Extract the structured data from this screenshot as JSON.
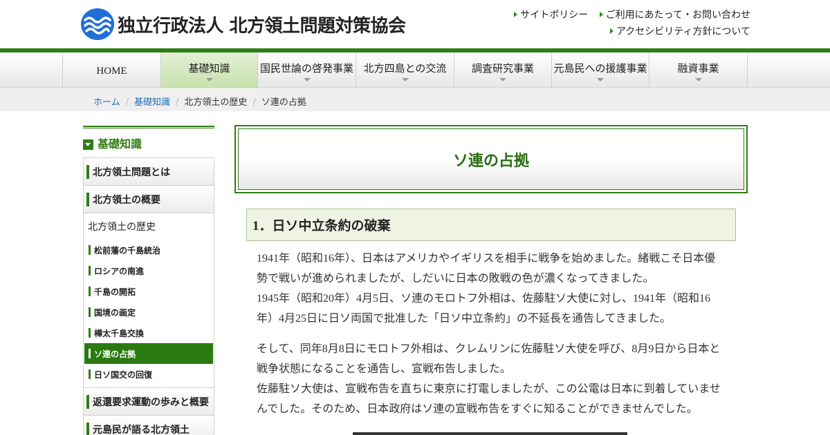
{
  "header": {
    "org_name": "独立行政法人 北方領土問題対策協会",
    "util_links": [
      [
        "サイトポリシー",
        "ご利用にあたって・お問い合わせ"
      ],
      [
        "アクセシビリティ方針について"
      ]
    ],
    "brand_color": "#2f7d16",
    "logo_color": "#1f6fd6"
  },
  "global_nav": [
    {
      "label": "HOME",
      "active": false,
      "has_dropdown": false
    },
    {
      "label": "基礎知識",
      "active": true,
      "has_dropdown": true
    },
    {
      "label": "国民世論の啓発事業",
      "active": false,
      "has_dropdown": true
    },
    {
      "label": "北方四島との交流",
      "active": false,
      "has_dropdown": true
    },
    {
      "label": "調査研究事業",
      "active": false,
      "has_dropdown": true
    },
    {
      "label": "元島民への援護事業",
      "active": false,
      "has_dropdown": true
    },
    {
      "label": "融資事業",
      "active": false,
      "has_dropdown": true
    }
  ],
  "breadcrumb": {
    "links": [
      "ホーム",
      "基礎知識"
    ],
    "texts": [
      "北方領土の歴史",
      "ソ連の占拠"
    ]
  },
  "side_nav": {
    "heading": "基礎知識",
    "majors_top": [
      "北方領土問題とは",
      "北方領土の概要"
    ],
    "sub_heading": "北方領土の歴史",
    "minors": [
      {
        "label": "松前藩の千島統治",
        "active": false
      },
      {
        "label": "ロシアの南進",
        "active": false
      },
      {
        "label": "千島の開拓",
        "active": false
      },
      {
        "label": "国境の画定",
        "active": false
      },
      {
        "label": "樺太千島交換",
        "active": false
      },
      {
        "label": "ソ連の占拠",
        "active": true
      },
      {
        "label": "日ソ国交の回復",
        "active": false
      }
    ],
    "majors_bottom": [
      "返還要求運動の歩みと概要",
      "元島民が語る北方領土"
    ]
  },
  "main": {
    "page_title": "ソ連の占拠",
    "section_heading": "1．日ソ中立条約の破棄",
    "paragraphs": [
      [
        "1941年（昭和16年）、日本はアメリカやイギリスを相手に戦争を始めました。緒戦こそ日本優",
        "勢で戦いが進められましたが、しだいに日本の敗戦の色が濃くなってきました。",
        "1945年（昭和20年）4月5日、ソ連のモロトフ外相は、佐藤駐ソ大使に対し、1941年（昭和16",
        "年）4月25日に日ソ両国で批准した「日ソ中立条約」の不延長を通告してきました。"
      ],
      [
        "そして、同年8月8日にモロトフ外相は、クレムリンに佐藤駐ソ大使を呼び、8月9日から日本と",
        "戦争状態になることを通告し、宣戦布告しました。",
        "佐藤駐ソ大使は、宣戦布告を直ちに東京に打電しましたが、この公電は日本に到着していませ",
        "んでした。そのため、日本政府はソ連の宣戦布告をすぐに知ることができませんでした。"
      ]
    ]
  }
}
